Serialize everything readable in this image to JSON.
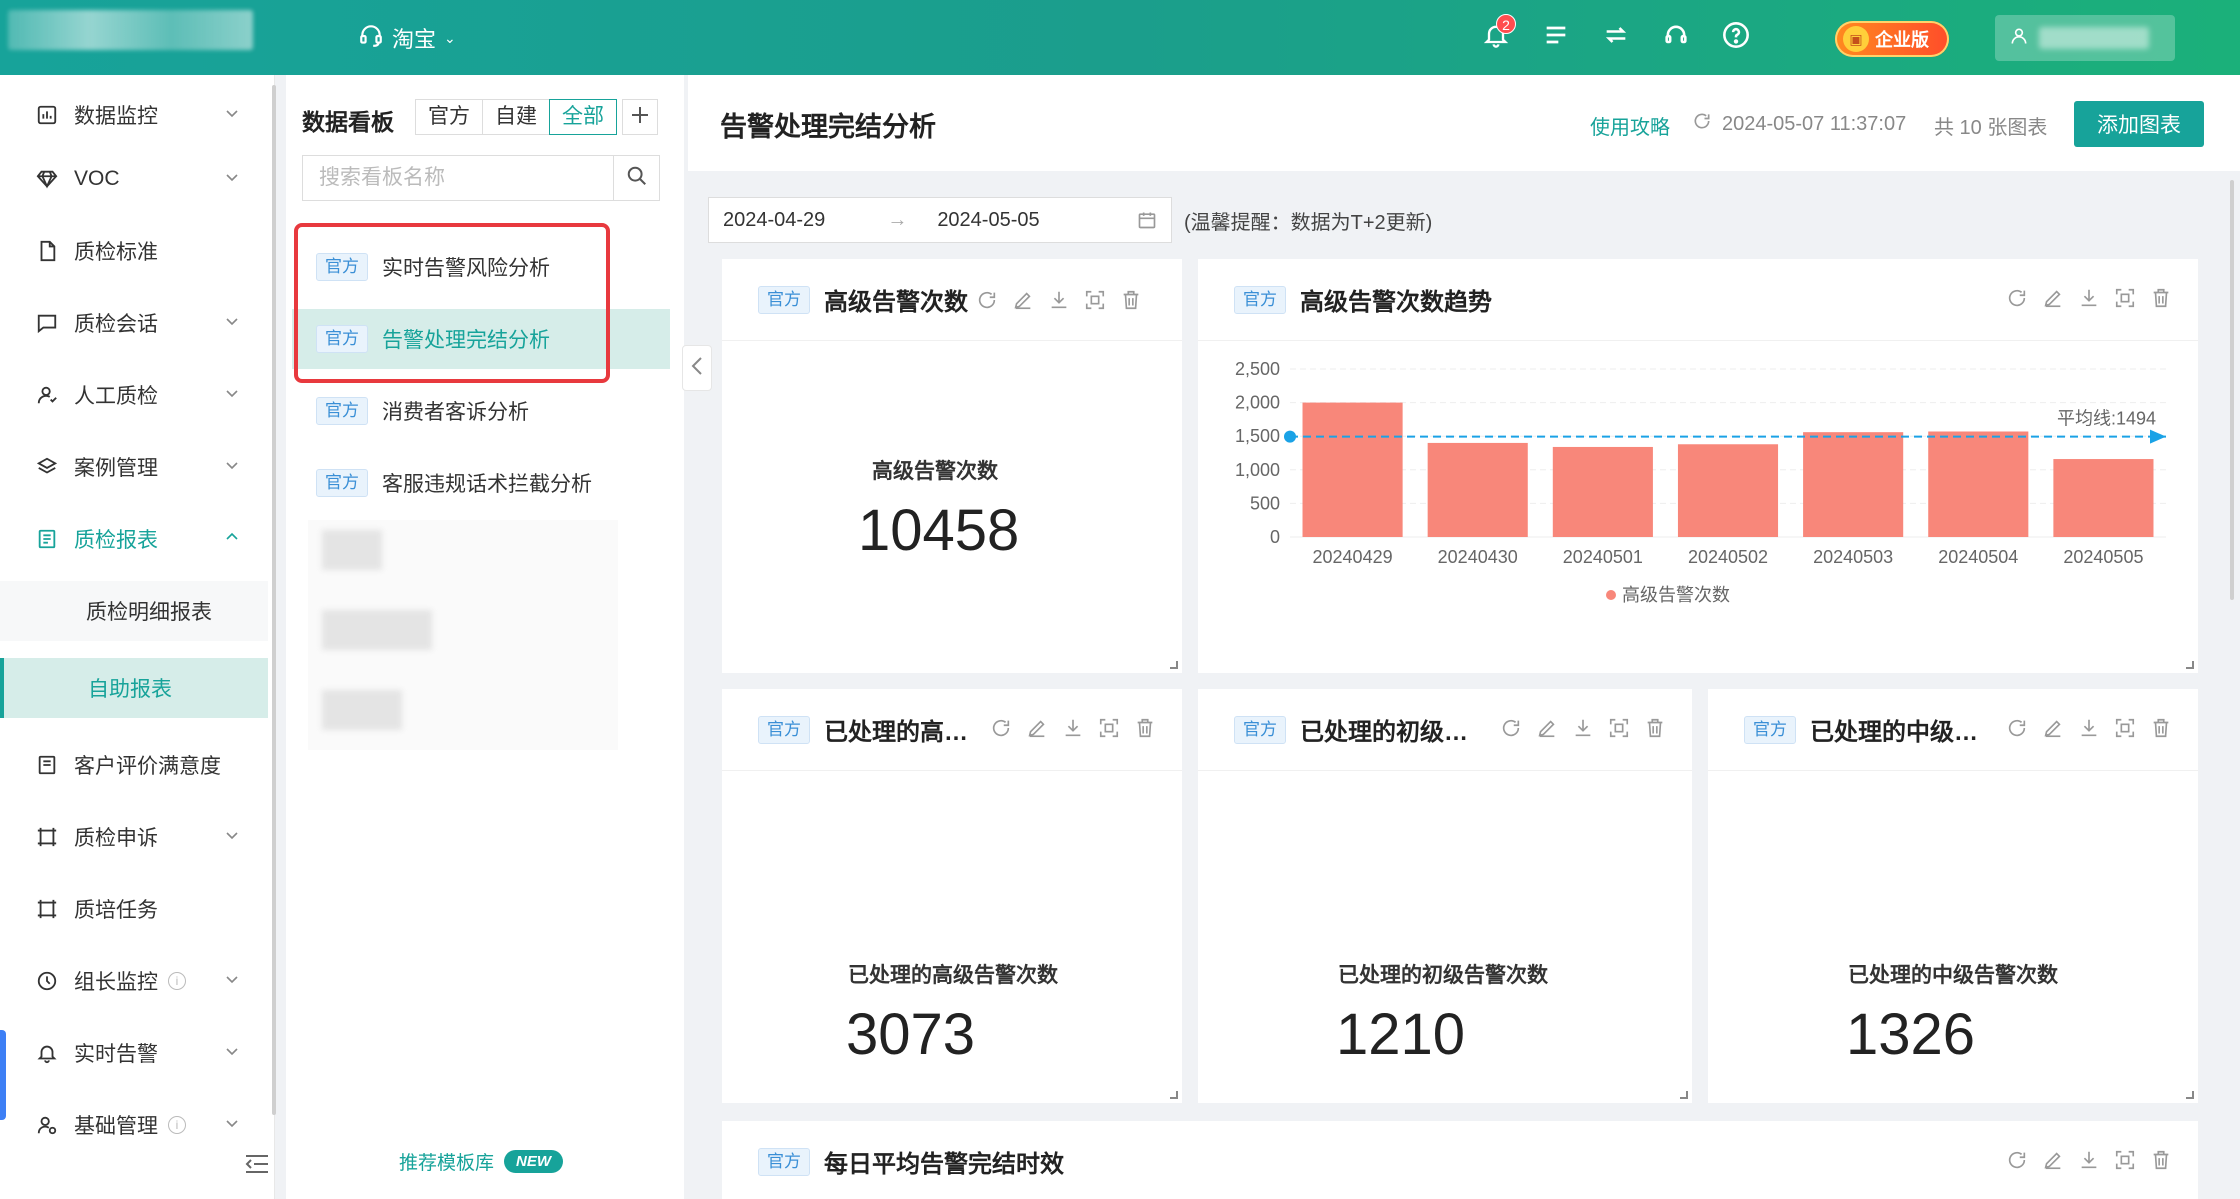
{
  "topbar": {
    "shop_name": "淘宝",
    "notifications_count": "2",
    "edition_label": "企业版",
    "brand_color": "#17a39a"
  },
  "nav": {
    "items": [
      {
        "label": "数据监控",
        "icon": "bar-chart-icon"
      },
      {
        "label": "VOC",
        "icon": "diamond-icon"
      },
      {
        "label": "质检标准",
        "icon": "document-icon"
      },
      {
        "label": "质检会话",
        "icon": "chat-icon"
      },
      {
        "label": "人工质检",
        "icon": "person-icon"
      },
      {
        "label": "案例管理",
        "icon": "layers-icon"
      },
      {
        "label": "质检报表",
        "icon": "report-icon"
      },
      {
        "label": "客户评价满意度",
        "icon": "list-icon"
      },
      {
        "label": "质检申诉",
        "icon": "frame-icon"
      },
      {
        "label": "质培任务",
        "icon": "frame-icon"
      },
      {
        "label": "组长监控",
        "icon": "clock-icon"
      },
      {
        "label": "实时告警",
        "icon": "bell-icon"
      },
      {
        "label": "基础管理",
        "icon": "user-gear-icon"
      }
    ],
    "report_subs": [
      "质检明细报表",
      "自助报表"
    ]
  },
  "boards": {
    "title": "数据看板",
    "filters": [
      "官方",
      "自建",
      "全部"
    ],
    "active_filter": "全部",
    "search_placeholder": "搜索看板名称",
    "tag": "官方",
    "items": [
      "实时告警风险分析",
      "告警处理完结分析",
      "消费者客诉分析",
      "客服违规话术拦截分析"
    ],
    "selected": "告警处理完结分析",
    "template_link": "推荐模板库",
    "new_badge": "NEW"
  },
  "main": {
    "title": "告警处理完结分析",
    "guide_link": "使用攻略",
    "updated_at": "2024-05-07 11:37:07",
    "chart_count": "共 10 张图表",
    "add_chart": "添加图表",
    "date_start": "2024-04-29",
    "date_end": "2024-05-05",
    "hint": "(温馨提醒：数据为T+2更新)"
  },
  "cards": {
    "tag": "官方",
    "high_count": {
      "title": "高级告警次数",
      "label": "高级告警次数",
      "value": "10458"
    },
    "high_trend": {
      "title": "高级告警次数趋势"
    },
    "handled_high": {
      "title": "已处理的高…",
      "label": "已处理的高级告警次数",
      "value": "3073"
    },
    "handled_low": {
      "title": "已处理的初级…",
      "label": "已处理的初级告警次数",
      "value": "1210"
    },
    "handled_mid": {
      "title": "已处理的中级…",
      "label": "已处理的中级告警次数",
      "value": "1326"
    },
    "daily_avg": {
      "title": "每日平均告警完结时效"
    }
  },
  "chart_data": {
    "type": "bar",
    "title": "高级告警次数趋势",
    "categories": [
      "20240429",
      "20240430",
      "20240501",
      "20240502",
      "20240503",
      "20240504",
      "20240505"
    ],
    "series": [
      {
        "name": "高级告警次数",
        "values": [
          2000,
          1400,
          1340,
          1380,
          1560,
          1570,
          1160
        ],
        "color": "#f8877a"
      }
    ],
    "y_ticks": [
      "0",
      "500",
      "1,000",
      "1,500",
      "2,000",
      "2,500"
    ],
    "ylim": [
      0,
      2500
    ],
    "average_line": {
      "label": "平均线:1494",
      "value": 1494,
      "color": "#1aa2e6"
    },
    "grid": true,
    "legend": "bottom"
  }
}
